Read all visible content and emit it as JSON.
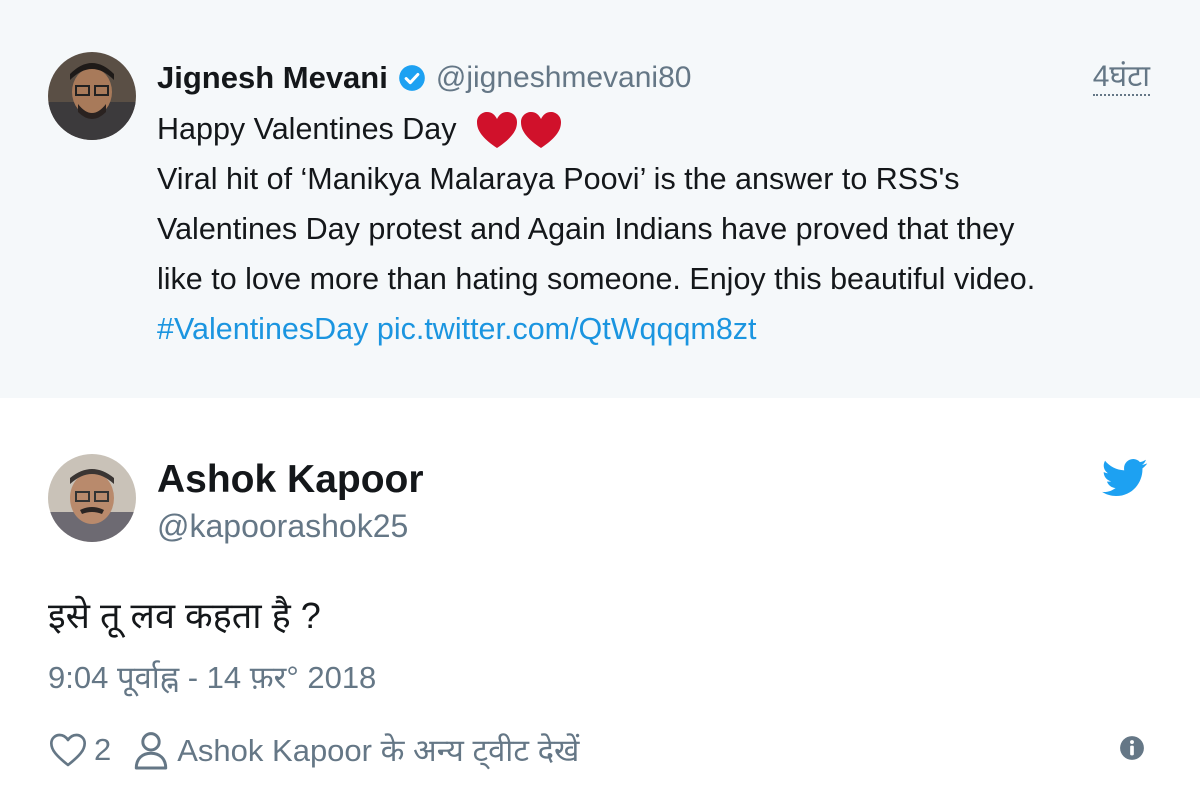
{
  "quoted_tweet": {
    "author_name": "Jignesh Mevani",
    "handle": "@jigneshmevani80",
    "time": "4घंटा",
    "lines": [
      "Happy Valentines Day",
      "Viral hit of ‘Manikya Malaraya Poovi’ is the answer to RSS's",
      "Valentines Day protest and Again Indians have proved that they",
      "like to love more than hating someone. Enjoy this beautiful video."
    ],
    "hashtag": "#ValentinesDay",
    "pic_link": "pic.twitter.com/QtWqqqm8zt",
    "icons": [
      "verified-badge-icon",
      "red-heart-emoji"
    ]
  },
  "reply_tweet": {
    "author_name": "Ashok Kapoor",
    "handle": "@kapoorashok25",
    "text": "इसे तू लव कहता है ?",
    "date": "9:04 पूर्वाह्न - 14 फ़र° 2018",
    "likes": "2",
    "see_more": "Ashok Kapoor के अन्य ट्वीट देखें",
    "icons": [
      "twitter-bird-icon",
      "heart-outline-icon",
      "person-icon",
      "info-icon"
    ]
  },
  "colors": {
    "quoted_background": "#f5f8fa",
    "link": "#1b95e0",
    "secondary_text": "#657786",
    "heart": "#e0245e",
    "twitter_blue": "#1da1f2"
  }
}
